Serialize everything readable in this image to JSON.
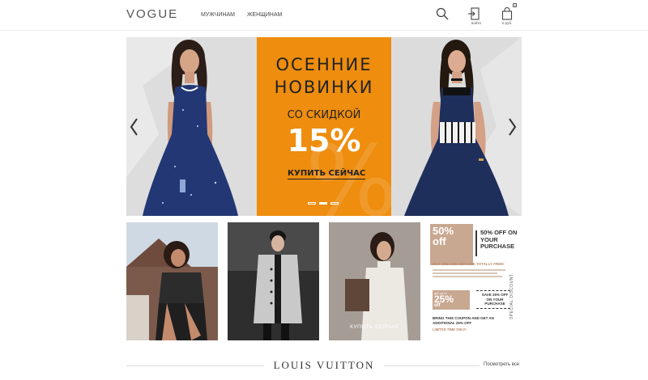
{
  "header": {
    "logo": "VOGUE",
    "nav": [
      {
        "label": "МУЖЧИНАМ"
      },
      {
        "label": "ЖЕНЩИНАМ"
      }
    ],
    "icons": {
      "search": "search-icon",
      "login": "login-icon",
      "cart": "cart-icon"
    },
    "login_label": "войти",
    "cart_label": "0 руб.",
    "cart_count": "0"
  },
  "hero": {
    "title_line1": "ОСЕННИЕ",
    "title_line2": "НОВИНКИ",
    "subtitle": "СО СКИДКОЙ",
    "discount": "15%",
    "watermark": "%",
    "cta": "КУПИТЬ СЕЙЧАС",
    "slides": 3,
    "active_slide": 2,
    "accent": "#ee8d0e"
  },
  "tiles": [
    {
      "id": "look-1"
    },
    {
      "id": "look-2"
    },
    {
      "id": "look-3",
      "cta": "КУПИТЬ СЕЙЧАС"
    },
    {
      "id": "promo",
      "top_badge_a": "50%",
      "top_badge_b": "off",
      "right_text": "50% OFF ON YOUR PURCHASE",
      "buy_line": "BUY ONE AND GET ONE TOTALLY FREE!",
      "coupon_up": "get up to",
      "coupon_pct": "25%",
      "coupon_off": "off",
      "save_text": "SAVE 25% OFF ON YOUR PURCHASE",
      "bring_text": "BRING THIS COUPON AND GET AN ADDITIONAL 25% OFF",
      "limited": "LIMITED TIME ONLY!",
      "special": "SPECIAL DISCOUNT"
    }
  ],
  "brand_section": {
    "title": "LOUIS VUITTON",
    "view_all": "Посмотреть все"
  }
}
